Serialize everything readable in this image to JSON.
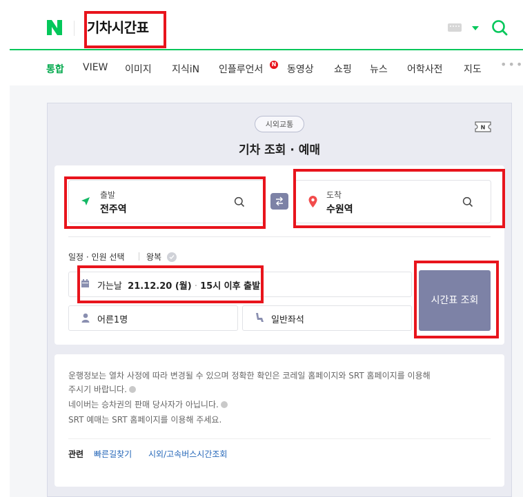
{
  "header": {
    "logo": "N",
    "query": "기차시간표"
  },
  "tabs": [
    {
      "label": "통합",
      "active": true
    },
    {
      "label": "VIEW"
    },
    {
      "label": "이미지"
    },
    {
      "label": "지식iN"
    },
    {
      "label": "인플루언서"
    },
    {
      "label": "동영상"
    },
    {
      "label": "쇼핑"
    },
    {
      "label": "뉴스"
    },
    {
      "label": "어학사전"
    },
    {
      "label": "지도"
    }
  ],
  "influencer_badge": "N",
  "more_label": "•••",
  "card": {
    "chip": "시외교통",
    "title": "기차 조회 · 예매",
    "departure": {
      "label": "출발",
      "value": "전주역"
    },
    "arrival": {
      "label": "도착",
      "value": "수원역"
    },
    "schedule_label": "일정 · 인원 선택",
    "round_trip_label": "왕복",
    "date": {
      "prefix": "가는날",
      "value": "21.12.20 (월)",
      "separator": "·",
      "time": "15시 이후 출발"
    },
    "passengers": "어른1명",
    "seat_class": "일반좌석",
    "search_button": "시간표 조회"
  },
  "info": {
    "lines": [
      "운행정보는 열차 사정에 따라 변경될 수 있으며 정확한 확인은 코레일 홈페이지와 SRT 홈페이지를 이용해",
      "주시기 바랍니다.",
      "네이버는 승차권의 판매 당사자가 아닙니다.",
      "SRT 예매는 SRT 홈페이지를 이용해 주세요."
    ],
    "related_label": "관련",
    "related_links": [
      "빠른길찾기",
      "시외/고속버스시간조회"
    ]
  },
  "colors": {
    "naver_green": "#03c75a",
    "accent_purple": "#7d82a6",
    "highlight_red": "#e8141c"
  }
}
